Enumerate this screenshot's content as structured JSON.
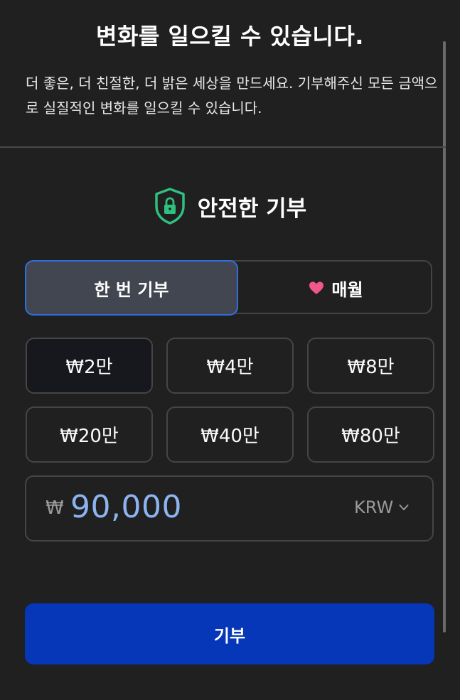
{
  "header": {
    "title": "변화를 일으킬 수 있습니다.",
    "description": "더 좋은, 더 친절한, 더 밝은 세상을 만드세요. 기부해주신 모든 금액으로 실질적인 변화를 일으킬 수 있습니다."
  },
  "secure": {
    "label": "안전한 기부",
    "icon": "shield-lock-icon",
    "color": "#2fbf7f"
  },
  "frequency": {
    "options": [
      {
        "label": "한 번 기부",
        "selected": true
      },
      {
        "label": "매월",
        "icon": "heart-icon",
        "selected": false
      }
    ],
    "heart_color": "#f0578a"
  },
  "amounts": [
    {
      "label": "₩2만",
      "selected": true
    },
    {
      "label": "₩4만",
      "selected": false
    },
    {
      "label": "₩8만",
      "selected": false
    },
    {
      "label": "₩20만",
      "selected": false
    },
    {
      "label": "₩40만",
      "selected": false
    },
    {
      "label": "₩80만",
      "selected": false
    }
  ],
  "custom_amount": {
    "symbol": "₩",
    "value": "90,000",
    "currency": "KRW"
  },
  "donate_button": {
    "label": "기부",
    "color": "#0537b8"
  }
}
